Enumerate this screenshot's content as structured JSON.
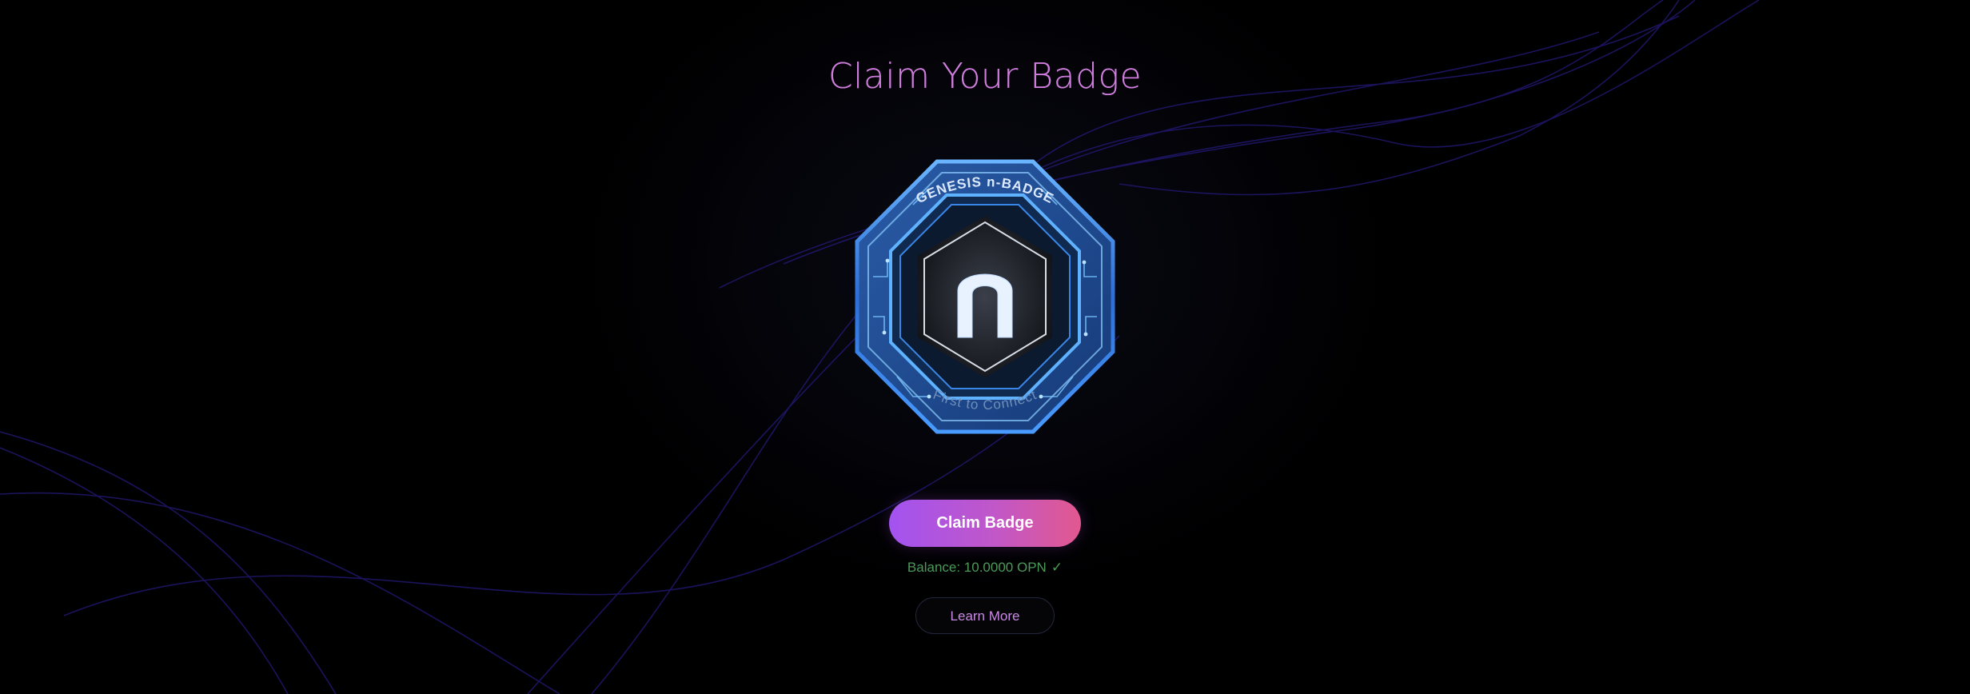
{
  "page": {
    "title": "Claim Your Badge"
  },
  "badge": {
    "top_text": "GENESIS n-BADGE",
    "bottom_text": "First to Connect",
    "emblem_icon": "n-logo-icon"
  },
  "actions": {
    "claim_label": "Claim Badge",
    "learn_more_label": "Learn More"
  },
  "wallet": {
    "balance_text": "Balance: 10.0000 OPN",
    "balance_check": "✓"
  },
  "colors": {
    "title": "#cf7ddd",
    "claim_gradient_start": "#a253f0",
    "claim_gradient_end": "#e2588f",
    "balance": "#4c9a5a",
    "learn_more_text": "#c98ae6",
    "badge_glow": "#3b8cff",
    "background": "#000000"
  }
}
